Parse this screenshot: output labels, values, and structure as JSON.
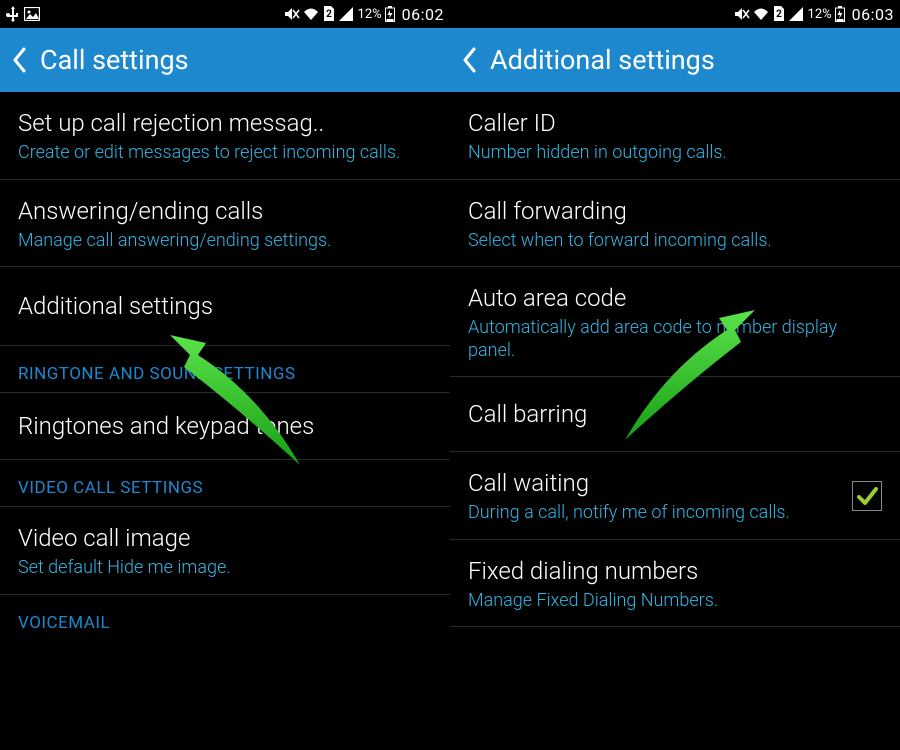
{
  "left": {
    "status": {
      "battery": "12%",
      "time": "06:02"
    },
    "header": {
      "title": "Call settings"
    },
    "items": {
      "rejection": {
        "title": "Set up call rejection messag..",
        "sub": "Create or edit messages to reject incoming calls."
      },
      "answering": {
        "title": "Answering/ending calls",
        "sub": "Manage call answering/ending settings."
      },
      "additional": {
        "title": "Additional settings"
      },
      "ringtones": {
        "title": "Ringtones and keypad tones"
      },
      "videoimg": {
        "title": "Video call image",
        "sub": "Set default Hide me image."
      }
    },
    "sections": {
      "ringtone": "RINGTONE AND SOUND SETTINGS",
      "videocall": "VIDEO CALL SETTINGS",
      "voicemail": "VOICEMAIL"
    }
  },
  "right": {
    "status": {
      "battery": "12%",
      "time": "06:03"
    },
    "header": {
      "title": "Additional settings"
    },
    "items": {
      "callerid": {
        "title": "Caller ID",
        "sub": "Number hidden in outgoing calls."
      },
      "forwarding": {
        "title": "Call forwarding",
        "sub": "Select when to forward incoming calls."
      },
      "autoarea": {
        "title": "Auto area code",
        "sub": "Automatically add area code to number display panel."
      },
      "barring": {
        "title": "Call barring"
      },
      "waiting": {
        "title": "Call waiting",
        "sub": "During a call, notify me of incoming calls."
      },
      "fdn": {
        "title": "Fixed dialing numbers",
        "sub": "Manage Fixed Dialing Numbers."
      }
    }
  }
}
